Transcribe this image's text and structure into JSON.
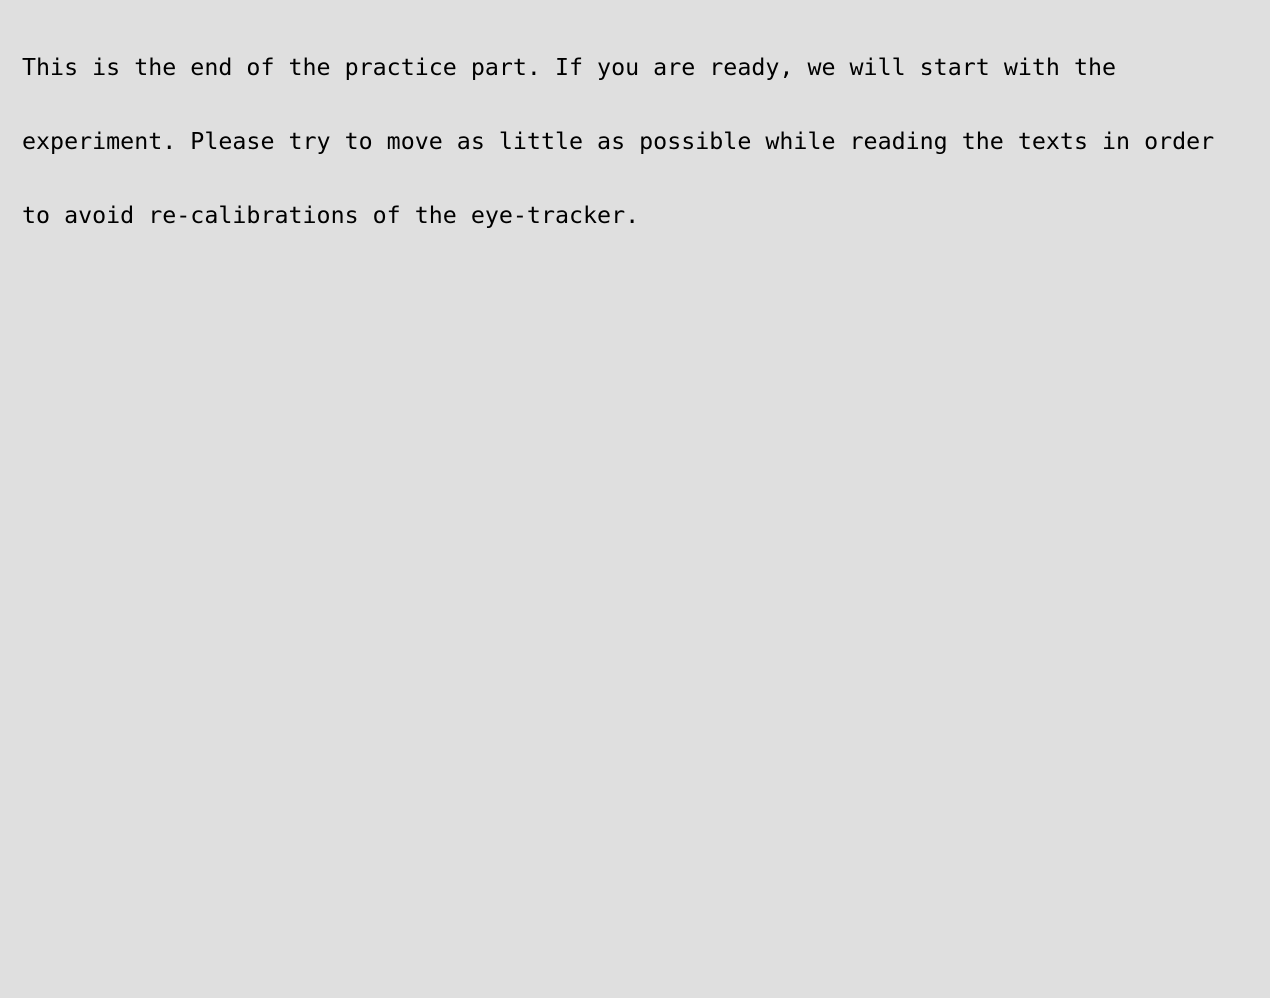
{
  "screen": {
    "background_color": "#dfdfdf",
    "text_color": "#000000",
    "lines": [
      "This is the end of the practice part. If you are ready, we will start with the",
      "experiment. Please try to move as little as possible while reading the texts in order",
      "to avoid re-calibrations of the eye-tracker."
    ]
  }
}
